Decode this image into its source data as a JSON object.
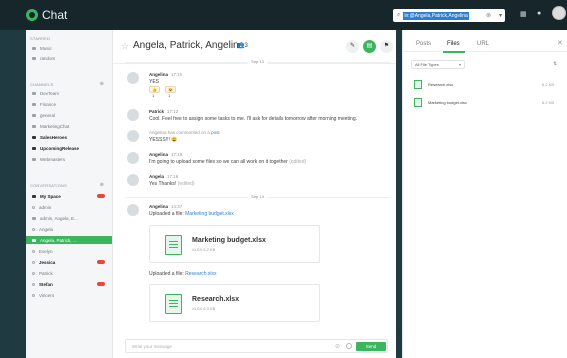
{
  "app": {
    "title": "Chat"
  },
  "search": {
    "value": "in:@Angela,Patrick,Angelina"
  },
  "sidebar": {
    "starred_header": "STARRED",
    "starred": [
      {
        "label": "Music"
      },
      {
        "label": "random"
      }
    ],
    "channels_header": "CHANNELS",
    "channels": [
      {
        "label": "DevTeam",
        "bold": false
      },
      {
        "label": "Finance",
        "bold": false
      },
      {
        "label": "general",
        "bold": false
      },
      {
        "label": "MarketingChat",
        "bold": false
      },
      {
        "label": "SalesHeroes",
        "bold": true
      },
      {
        "label": "UpcomingRelease",
        "bold": true
      },
      {
        "label": "Webmasters",
        "bold": false
      }
    ],
    "conversations_header": "CONVERSATIONS",
    "conversations": [
      {
        "label": "My Space",
        "bold": true,
        "badge": true
      },
      {
        "label": "admin"
      },
      {
        "label": "admin, Angela, E..."
      },
      {
        "label": "Angela"
      },
      {
        "label": "Angela, Patrick, ...",
        "active": true
      },
      {
        "label": "Evelyn"
      },
      {
        "label": "Jessica",
        "bold": true,
        "badge": true
      },
      {
        "label": "Patrick"
      },
      {
        "label": "Stefan",
        "bold": true,
        "badge": true
      },
      {
        "label": "Vincent"
      }
    ]
  },
  "channel": {
    "title": "Angela, Patrick, Angelina",
    "member_count": "3"
  },
  "messages": {
    "date1": "Sep 13",
    "m1": {
      "name": "Angelina",
      "time": "17:10",
      "text": "YES",
      "reactions": [
        "👍 1",
        "😺 1"
      ]
    },
    "m2": {
      "name": "Patrick",
      "time": "17:12",
      "text": "Cool. Feel free to assign some tasks to me. I'll ask for details tomorrow after morning meeting."
    },
    "m3": {
      "name": "Angelina",
      "system": "has commented on a",
      "link": "post",
      "text": "YESSS!!! 😀"
    },
    "m4": {
      "name": "Angelina",
      "time": "17:15",
      "text": "I'm going to upload some files so we can all work on it together",
      "edited": "(edited)"
    },
    "m5": {
      "name": "Angela",
      "time": "17:18",
      "text": "Yes Thanks!",
      "edited": "(edited)"
    },
    "date2": "Sep 14",
    "m6": {
      "name": "Angelina",
      "time": "14:37",
      "upload_text": "Uploaded a file:",
      "upload_link": "Marketing budget.xlsx",
      "file1": {
        "name": "Marketing budget.xlsx",
        "size": "XLSX 6.2 KB"
      },
      "upload_text2": "Uploaded a file:",
      "upload_link2": "Research.xlsx",
      "file2": {
        "name": "Research.xlsx",
        "size": "XLSX 6.3 KB"
      }
    }
  },
  "composer": {
    "placeholder": "Write your message",
    "send": "Send"
  },
  "right_panel": {
    "tabs": [
      "Posts",
      "Files",
      "URL"
    ],
    "active_tab": "Files",
    "filter": "All File Types",
    "files": [
      {
        "name": "Research.xlsx",
        "size": "6.2 KB"
      },
      {
        "name": "Marketing budget.xlsx",
        "size": "6.2 KB"
      }
    ]
  },
  "colors": {
    "accent": "#3cb55e",
    "topbar": "#16262b",
    "link": "#2f7fd1",
    "badge": "#e8453c"
  }
}
